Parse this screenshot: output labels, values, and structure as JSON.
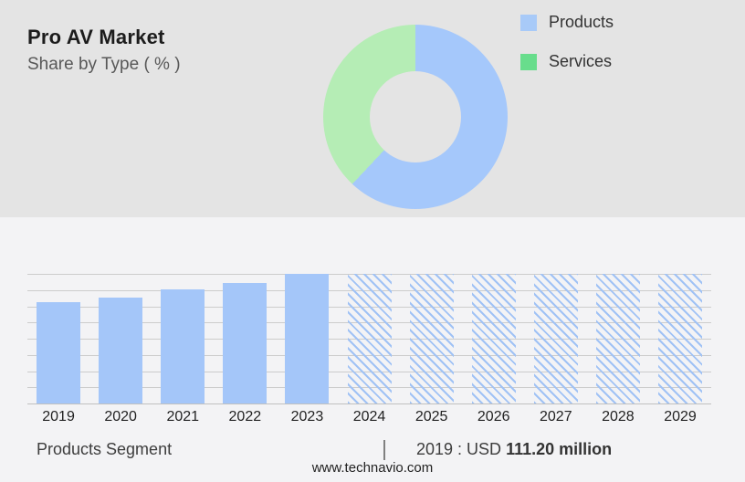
{
  "header": {
    "title": "Pro AV Market",
    "subtitle": "Share by Type ( % )"
  },
  "legend": {
    "items": [
      {
        "label": "Products",
        "color": "#a8caf8"
      },
      {
        "label": "Services",
        "color": "#68dd8c"
      }
    ]
  },
  "chart_data": [
    {
      "type": "pie",
      "subtype": "donut",
      "title": "Share by Type ( % )",
      "labels": [
        "Products",
        "Services"
      ],
      "values": [
        62,
        38
      ],
      "colors": [
        "#a5c8fb",
        "#b5edb5"
      ],
      "start_angle_deg": 0,
      "inner_radius_ratio": 0.5,
      "legend_position": "right"
    },
    {
      "type": "bar",
      "title": "Products Segment",
      "categories": [
        "2019",
        "2020",
        "2021",
        "2022",
        "2023",
        "2024",
        "2025",
        "2026",
        "2027",
        "2028",
        "2029"
      ],
      "values": [
        78,
        82,
        88,
        93,
        100,
        100,
        100,
        100,
        100,
        100,
        100
      ],
      "value_note": "no y-axis labels in source; values estimated as % of tallest (2023) bar; 2024-2029 are hatched forecast placeholders at full height",
      "actual_categories": [
        "2019",
        "2020",
        "2021",
        "2022",
        "2023"
      ],
      "forecast_categories": [
        "2024",
        "2025",
        "2026",
        "2027",
        "2028",
        "2029"
      ],
      "forecast_style": "diagonal-hatch",
      "bar_color": "#a4c6f9",
      "hatch_color": "#a0c2f5",
      "xlabel": "",
      "ylabel": "",
      "ylim": [
        0,
        100
      ],
      "grid": true,
      "gridline_count": 9
    }
  ],
  "caption": {
    "left": "Products Segment",
    "divider": "|",
    "value_prefix": "2019 : USD ",
    "value_bold": "111.20 million"
  },
  "footer": {
    "url": "www.technavio.com"
  },
  "colors": {
    "top_panel_bg": "#e4e4e4",
    "bottom_panel_bg": "#f3f3f5",
    "gridline": "#cccccc"
  }
}
